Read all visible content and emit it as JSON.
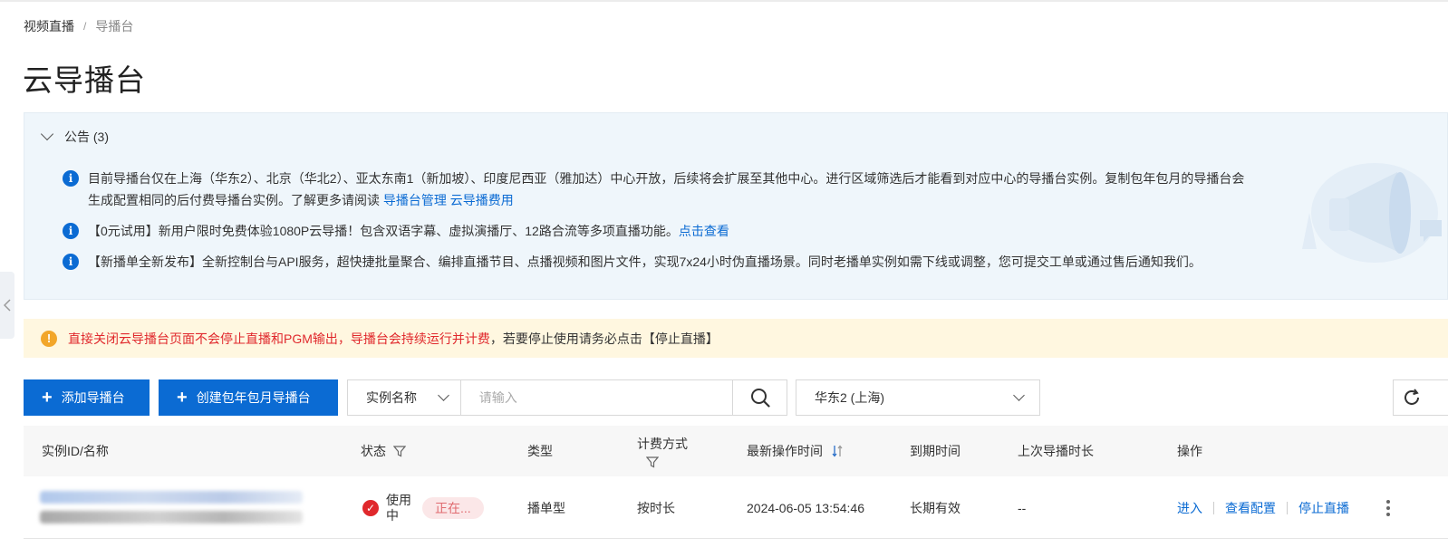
{
  "breadcrumb": {
    "root": "视频直播",
    "separator": "/",
    "current": "导播台"
  },
  "page_title": "云导播台",
  "notice": {
    "title": "公告 (3)",
    "items": [
      {
        "text": "目前导播台仅在上海（华东2）、北京（华北2）、亚太东南1（新加坡）、印度尼西亚（雅加达）中心开放，后续将会扩展至其他中心。进行区域筛选后才能看到对应中心的导播台实例。复制包年包月的导播台会生成配置相同的后付费导播台实例。了解更多请阅读 ",
        "links": [
          "导播台管理",
          "云导播费用"
        ]
      },
      {
        "text": "【0元试用】新用户限时免费体验1080P云导播！包含双语字幕、虚拟演播厅、12路合流等多项直播功能。",
        "links": [
          "点击查看"
        ]
      },
      {
        "text": "【新播单全新发布】全新控制台与API服务，超快捷批量聚合、编排直播节目、点播视频和图片文件，实现7x24小时伪直播场景。同时老播单实例如需下线或调整，您可提交工单或通过售后通知我们。",
        "links": []
      }
    ]
  },
  "warning": {
    "red": "直接关闭云导播台页面不会停止直播和PGM输出，导播台会持续运行并计费",
    "normal": "，若要停止使用请务必点击【停止直播】"
  },
  "toolbar": {
    "add_label": "添加导播台",
    "create_label": "创建包年包月导播台",
    "search_field": "实例名称",
    "search_placeholder": "请输入",
    "region": "华东2 (上海)"
  },
  "table": {
    "headers": {
      "id_name": "实例ID/名称",
      "status": "状态",
      "type": "类型",
      "billing": "计费方式",
      "last_op": "最新操作时间",
      "expire": "到期时间",
      "last_duration": "上次导播时长",
      "actions": "操作"
    },
    "rows": [
      {
        "status": "使用中",
        "status_tag": "正在...",
        "type": "播单型",
        "billing": "按时长",
        "last_op": "2024-06-05 13:54:46",
        "expire": "长期有效",
        "last_duration": "--",
        "actions": [
          "进入",
          "查看配置",
          "停止直播"
        ]
      }
    ]
  },
  "colors": {
    "primary": "#0b6bd3",
    "danger": "#e0282c",
    "warning_bg": "#fff7e0",
    "notice_bg": "#eff6fb"
  }
}
